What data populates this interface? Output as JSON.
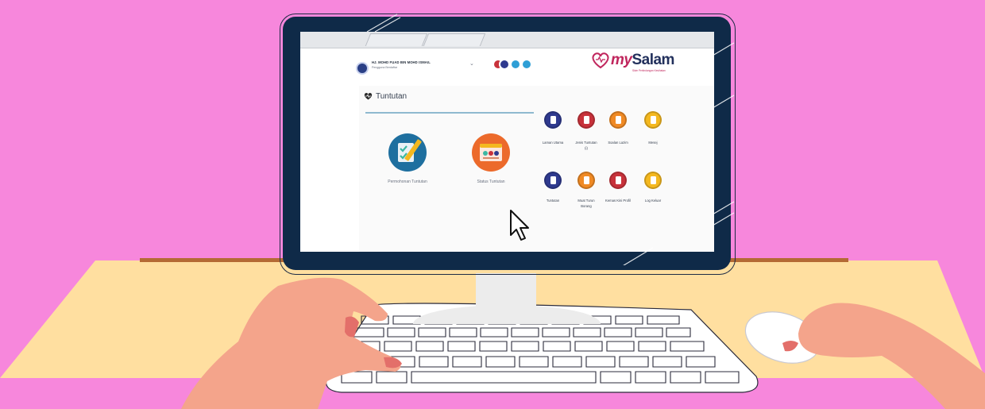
{
  "colors": {
    "background": "#f787dc",
    "desk": "#ffdfa0",
    "desk_edge": "#b46a34",
    "bezel": "#0f2a48",
    "brand_navy": "#22305c",
    "brand_red": "#c0265d"
  },
  "browser": {
    "tabs": [
      "",
      ""
    ]
  },
  "header": {
    "user_name": "HJ. MOHD FUAD BIN MOHD ISMAIL",
    "user_role": "Pengguna Berdaftar",
    "dropdown_icon": "chevron-down-icon",
    "header_icons": [
      "logo-icon",
      "circle-icon",
      "circle-icon",
      "circle-icon"
    ],
    "brand_my": "my",
    "brand_name": "Salam",
    "brand_tagline": "Skim Perlindungan Kesihatan"
  },
  "section": {
    "title": "Tuntutan",
    "icon": "heart-pulse-icon"
  },
  "main_tiles": [
    {
      "label": "Permohonan Tuntutan",
      "icon": "form-check-icon",
      "color": "#1e6f9f"
    },
    {
      "label": "Status Tuntutan",
      "icon": "browser-window-icon",
      "color": "#ec6a2b"
    }
  ],
  "side_menu": [
    {
      "label": "Laman Utama",
      "color": "#2f3a8f"
    },
    {
      "label": "Jenis Tuntutan (i)",
      "color": "#c8323b"
    },
    {
      "label": "Soalan Lazim",
      "color": "#f08a24"
    },
    {
      "label": "Mesej",
      "color": "#f4b81f"
    },
    {
      "label": "Tuntutan",
      "color": "#2f3a8f"
    },
    {
      "label": "Muat Turun Borang",
      "color": "#f08a24"
    },
    {
      "label": "Kemas Kini Profil",
      "color": "#c8323b"
    },
    {
      "label": "Log Keluar",
      "color": "#f4b81f"
    }
  ],
  "cursor": {
    "icon": "mouse-pointer-icon"
  }
}
